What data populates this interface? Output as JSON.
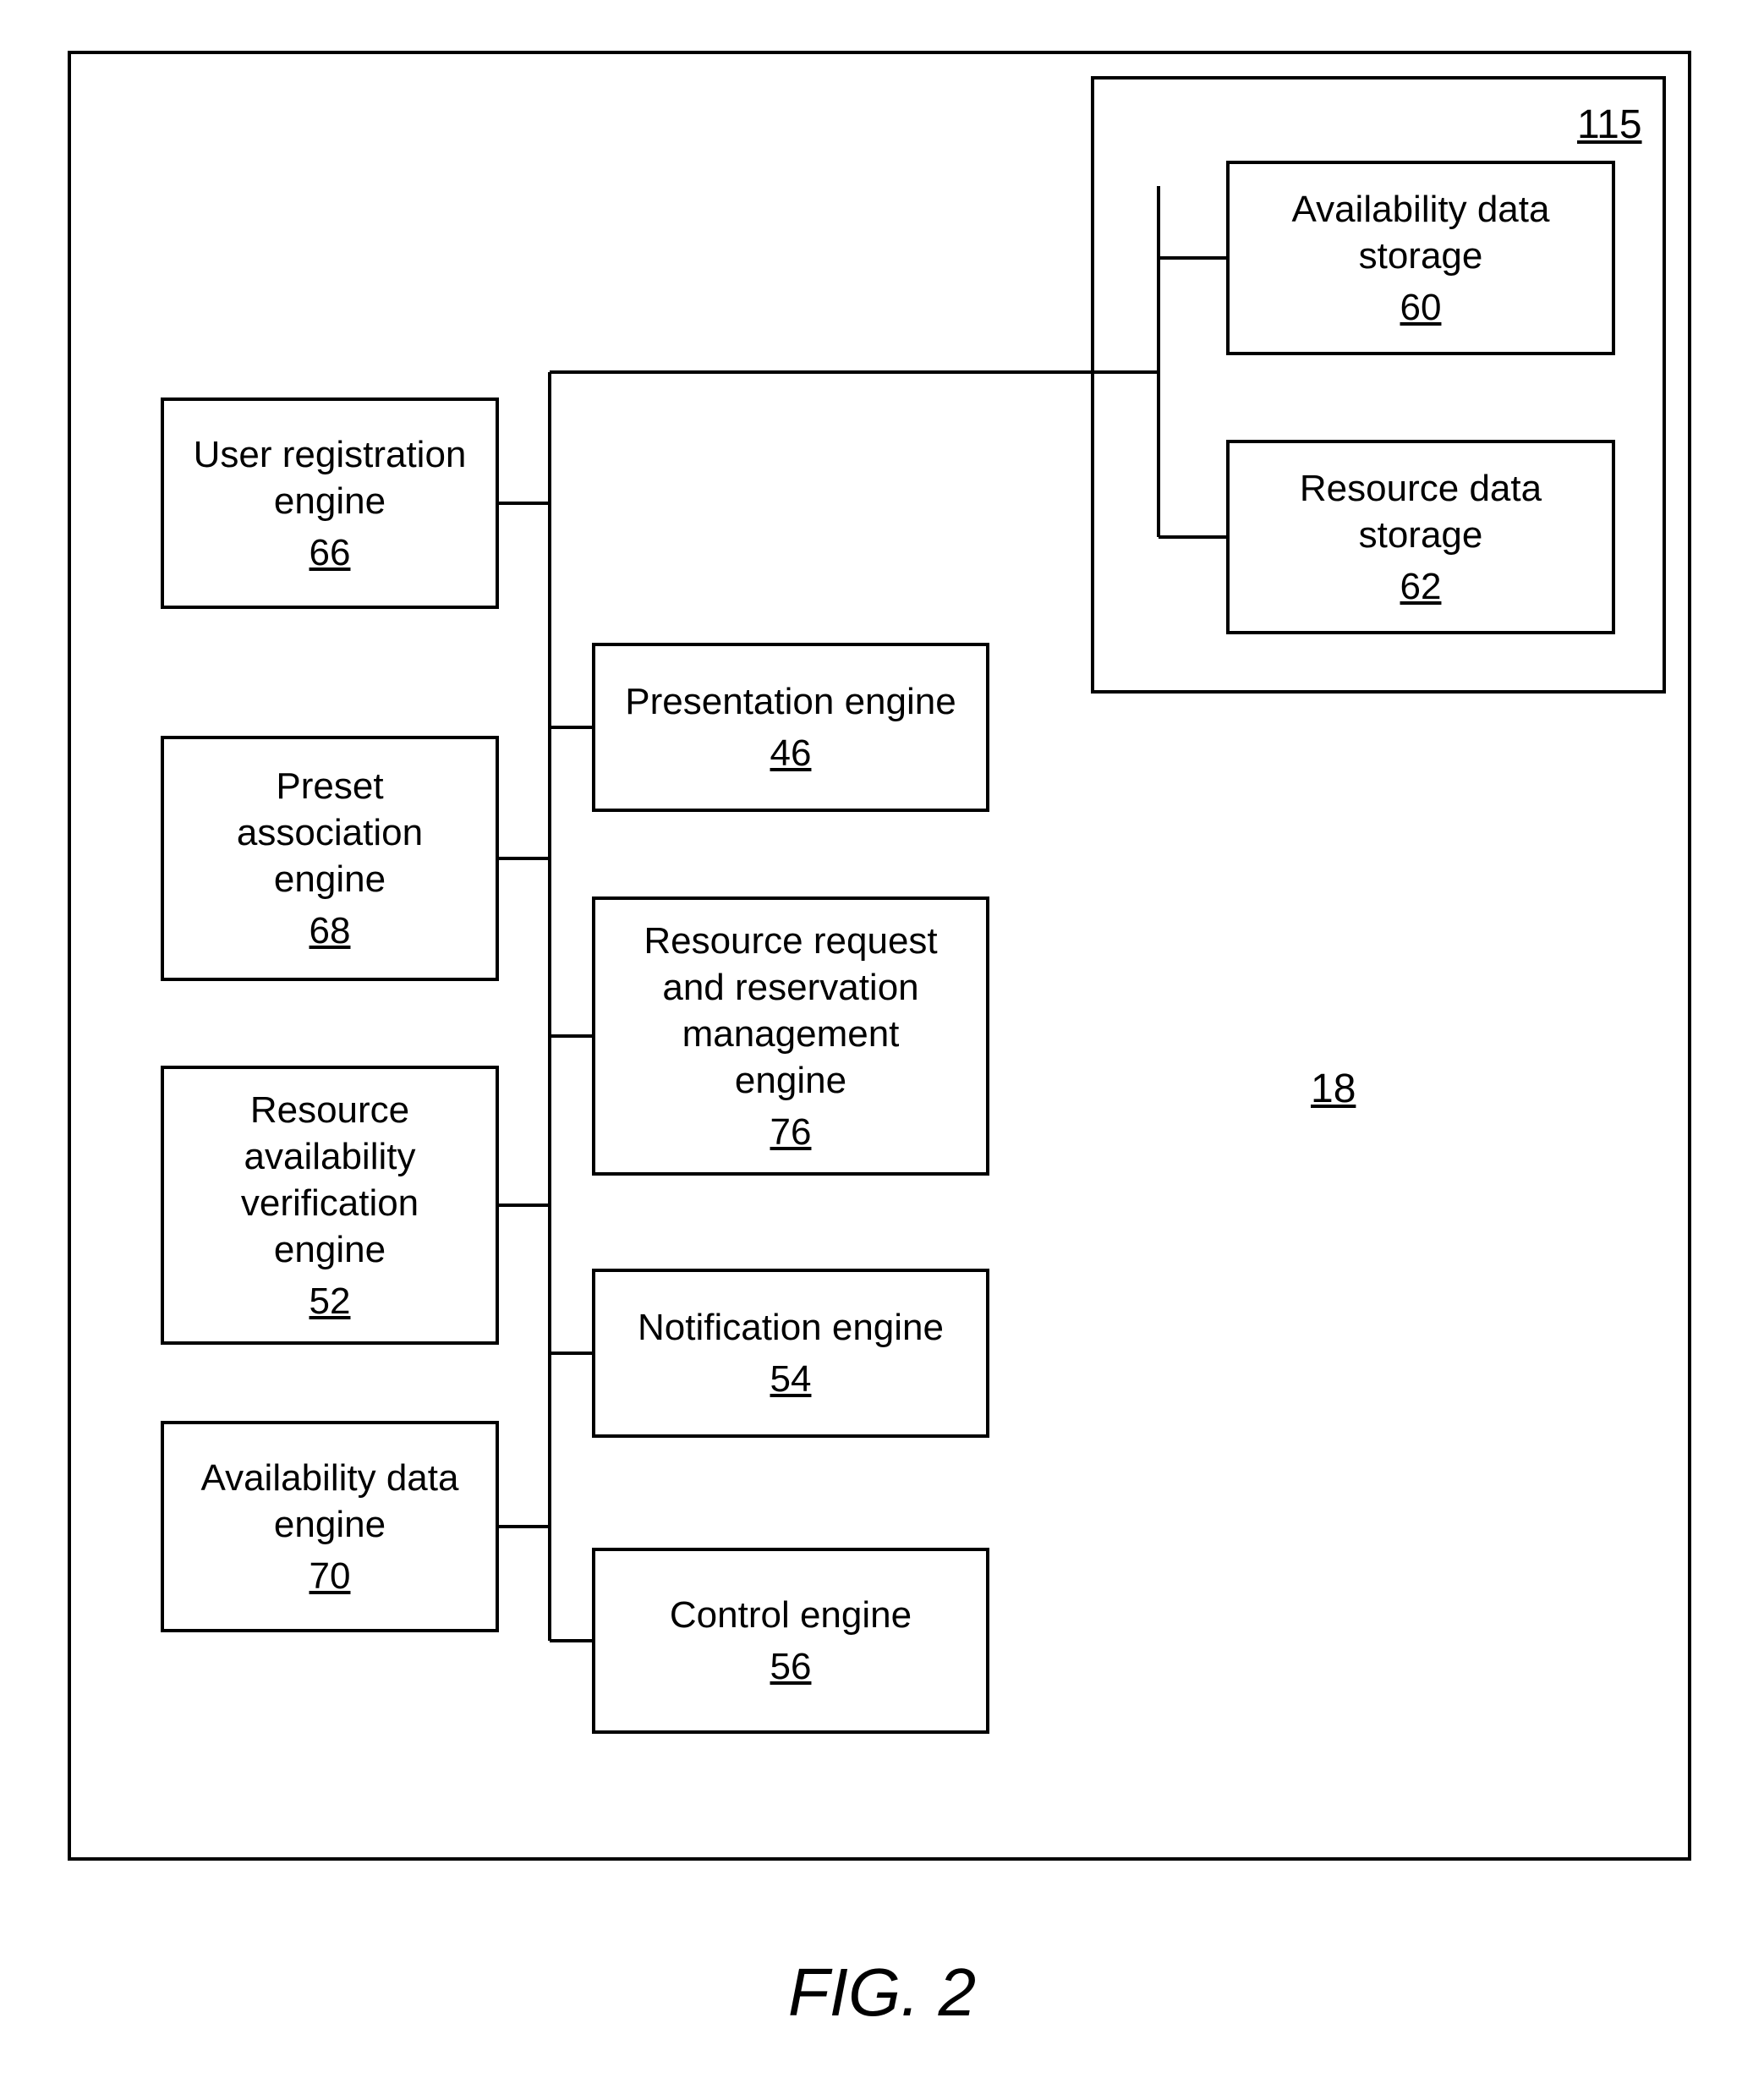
{
  "figure_caption": "FIG. 2",
  "outer": {
    "main_ref": "18",
    "storage_ref": "115"
  },
  "left_column": [
    {
      "label": "User registration\nengine",
      "ref": "66"
    },
    {
      "label": "Preset\nassociation\nengine",
      "ref": "68"
    },
    {
      "label": "Resource\navailability\nverification\nengine",
      "ref": "52"
    },
    {
      "label": "Availability data\nengine",
      "ref": "70"
    }
  ],
  "middle_column": [
    {
      "label": "Presentation engine",
      "ref": "46"
    },
    {
      "label": "Resource request\nand reservation\nmanagement\nengine",
      "ref": "76"
    },
    {
      "label": "Notification engine",
      "ref": "54"
    },
    {
      "label": "Control engine",
      "ref": "56"
    }
  ],
  "storage": [
    {
      "label": "Availability data\nstorage",
      "ref": "60"
    },
    {
      "label": "Resource data\nstorage",
      "ref": "62"
    }
  ]
}
